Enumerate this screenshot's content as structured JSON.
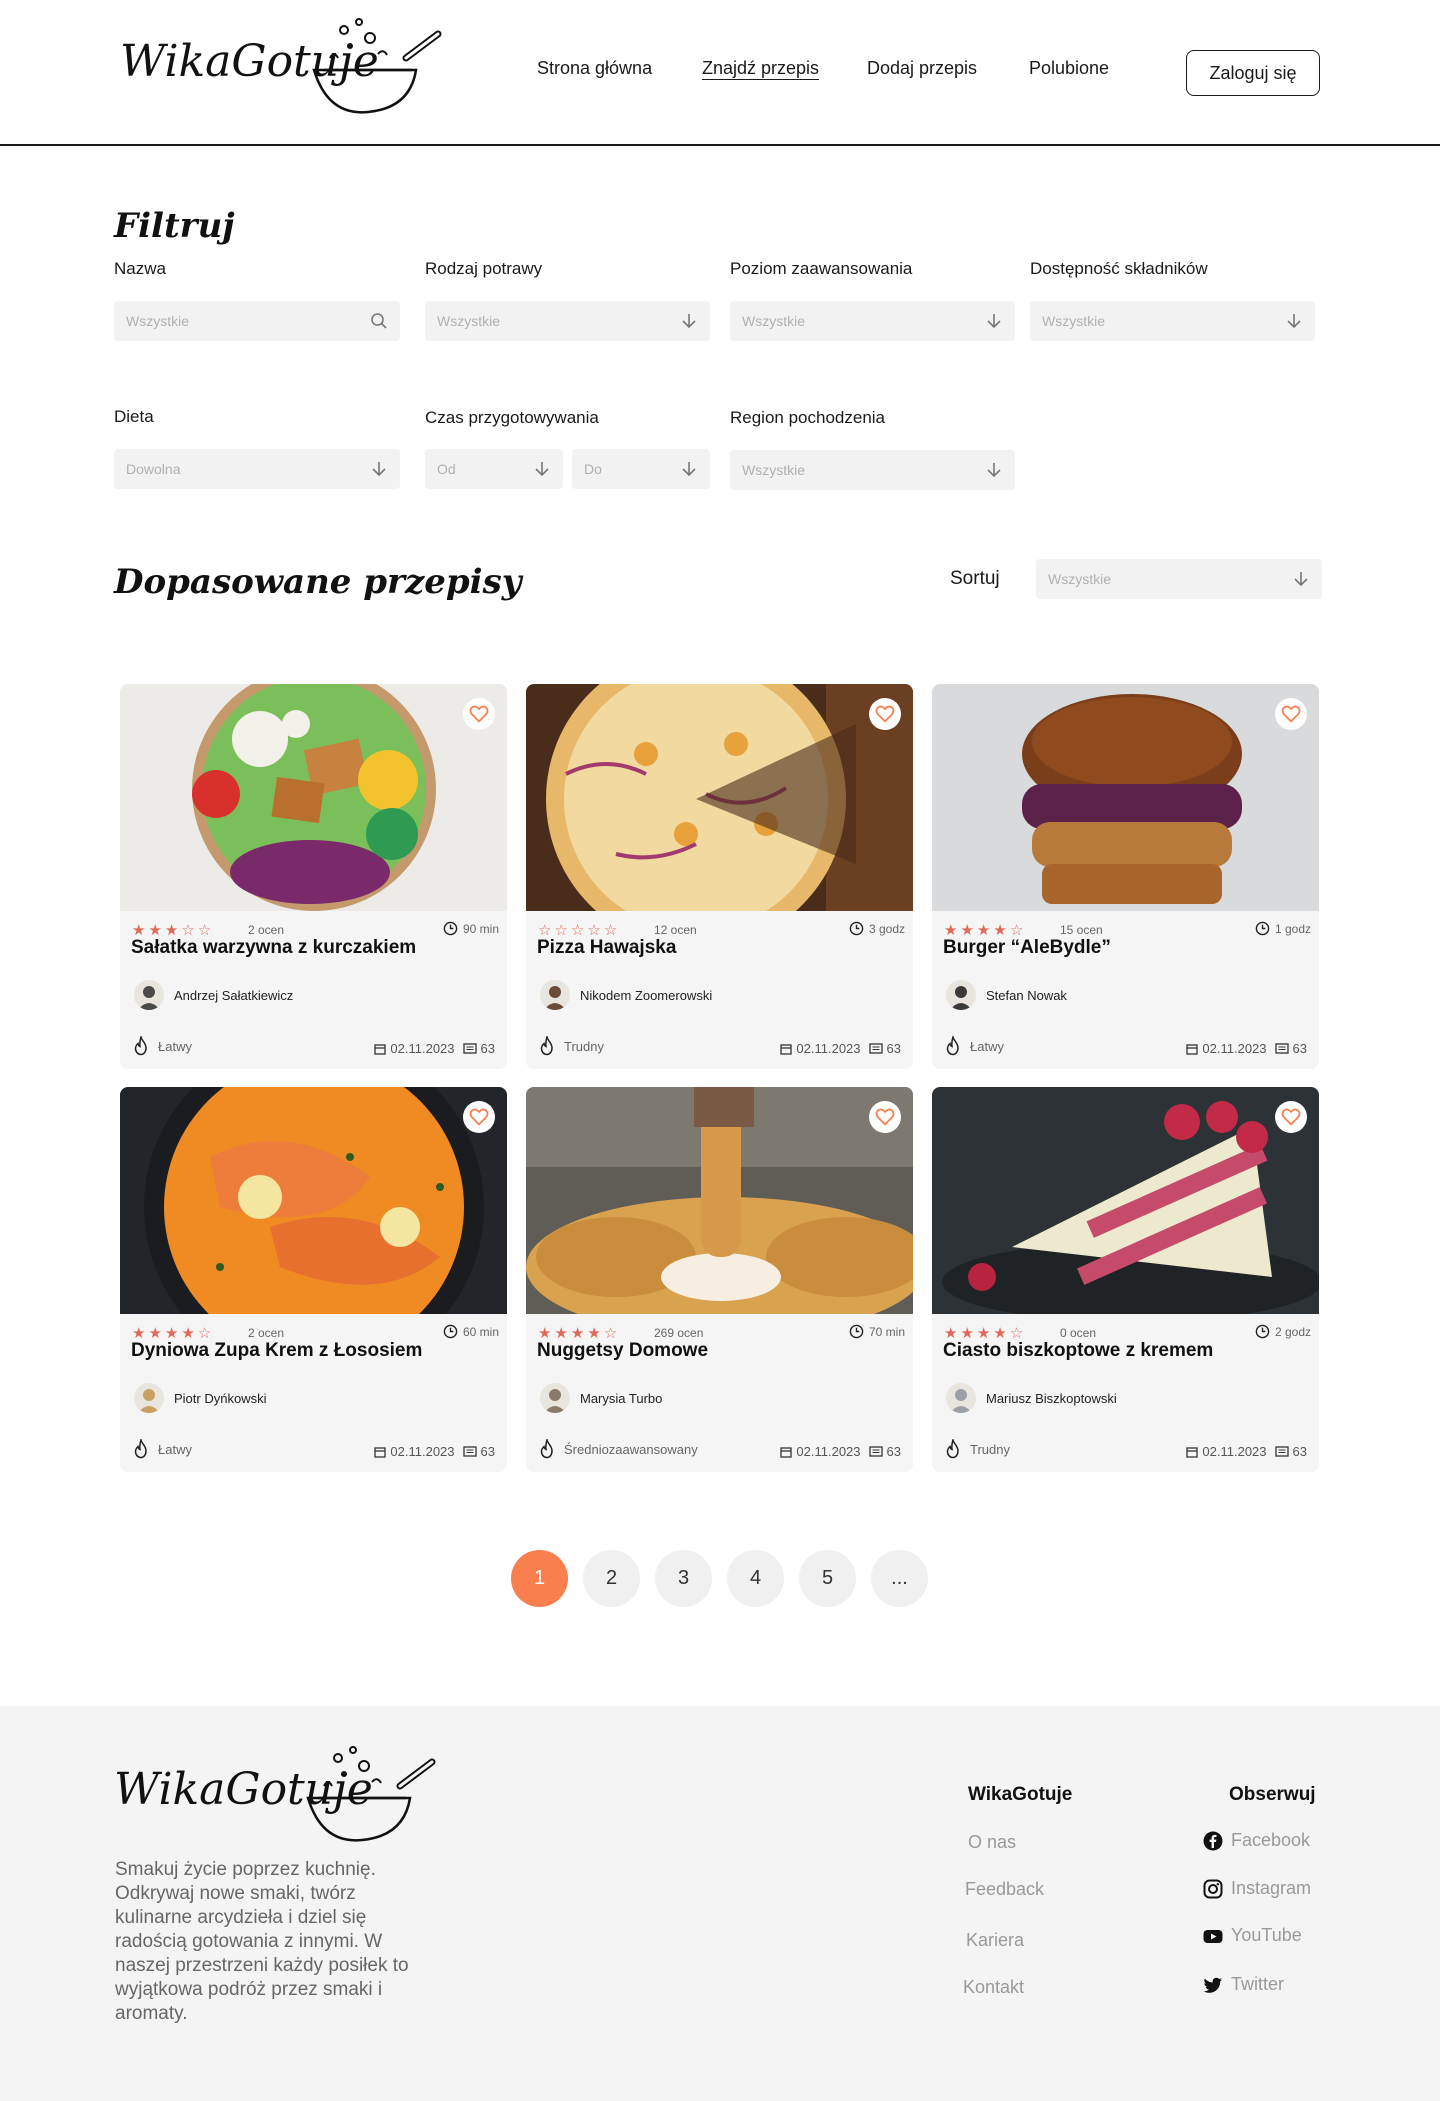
{
  "brand": {
    "name": "WikaGotuje"
  },
  "nav": {
    "items": [
      "Strona główna",
      "Znajdź przepis",
      "Dodaj przepis",
      "Polubione"
    ],
    "active": "Znajdź przepis",
    "login": "Zaloguj się"
  },
  "filters": {
    "title": "Filtruj",
    "name": {
      "label": "Nazwa",
      "placeholder": "Wszystkie"
    },
    "dish_type": {
      "label": "Rodzaj potrawy",
      "placeholder": "Wszystkie"
    },
    "level": {
      "label": "Poziom zaawansowania",
      "placeholder": "Wszystkie"
    },
    "ingredients": {
      "label": "Dostępność składników",
      "placeholder": "Wszystkie"
    },
    "diet": {
      "label": "Dieta",
      "placeholder": "Dowolna"
    },
    "prep_time": {
      "label": "Czas przygotowywania",
      "from": "Od",
      "to": "Do"
    },
    "region": {
      "label": "Region pochodzenia",
      "placeholder": "Wszystkie"
    }
  },
  "results": {
    "title": "Dopasowane przepisy",
    "sort_label": "Sortuj",
    "sort_placeholder": "Wszystkie"
  },
  "recipes": [
    {
      "title": "Sałatka warzywna z kurczakiem",
      "rating": 3,
      "ratings": "2 ocen",
      "time": "90 min",
      "author": "Andrzej Sałatkiewicz",
      "difficulty": "Łatwy",
      "date": "02.11.2023",
      "comments": "63"
    },
    {
      "title": "Pizza Hawajska",
      "rating": 0,
      "ratings": "12 ocen",
      "time": "3 godz",
      "author": "Nikodem Zoomerowski",
      "difficulty": "Trudny",
      "date": "02.11.2023",
      "comments": "63"
    },
    {
      "title": "Burger “AleBydle”",
      "rating": 4,
      "ratings": "15 ocen",
      "time": "1 godz",
      "author": "Stefan Nowak",
      "difficulty": "Łatwy",
      "date": "02.11.2023",
      "comments": "63"
    },
    {
      "title": "Dyniowa Zupa Krem z Łososiem",
      "rating": 4,
      "ratings": "2 ocen",
      "time": "60 min",
      "author": "Piotr Dyńkowski",
      "difficulty": "Łatwy",
      "date": "02.11.2023",
      "comments": "63"
    },
    {
      "title": "Nuggetsy Domowe",
      "rating": 4,
      "ratings": "269 ocen",
      "time": "70 min",
      "author": "Marysia Turbo",
      "difficulty": "Średniozaawansowany",
      "date": "02.11.2023",
      "comments": "63"
    },
    {
      "title": "Ciasto biszkoptowe z kremem",
      "rating": 4,
      "ratings": "0 ocen",
      "time": "2 godz",
      "author": "Mariusz Biszkoptowski",
      "difficulty": "Trudny",
      "date": "02.11.2023",
      "comments": "63"
    }
  ],
  "pagination": {
    "pages": [
      "1",
      "2",
      "3",
      "4",
      "5",
      "..."
    ],
    "current": "1"
  },
  "footer": {
    "description": "Smakuj życie poprzez kuchnię. Odkrywaj nowe smaki, twórz kulinarne arcydzieła i dziel się radością gotowania z innymi. W naszej przestrzeni każdy posiłek to wyjątkowa podróż przez smaki i aromaty.",
    "col1_title": "WikaGotuje",
    "col1_links": [
      "O nas",
      "Feedback",
      "Kariera",
      "Kontakt"
    ],
    "col2_title": "Obserwuj",
    "social": [
      {
        "label": "Facebook",
        "icon": "facebook-icon"
      },
      {
        "label": "Instagram",
        "icon": "instagram-icon"
      },
      {
        "label": "YouTube",
        "icon": "youtube-icon"
      },
      {
        "label": "Twitter",
        "icon": "twitter-icon"
      }
    ]
  },
  "colors": {
    "accent": "#f97f4f",
    "star": "#e06a5a",
    "input_bg": "#f2f2f2",
    "footer_bg": "#f4f4f4"
  }
}
